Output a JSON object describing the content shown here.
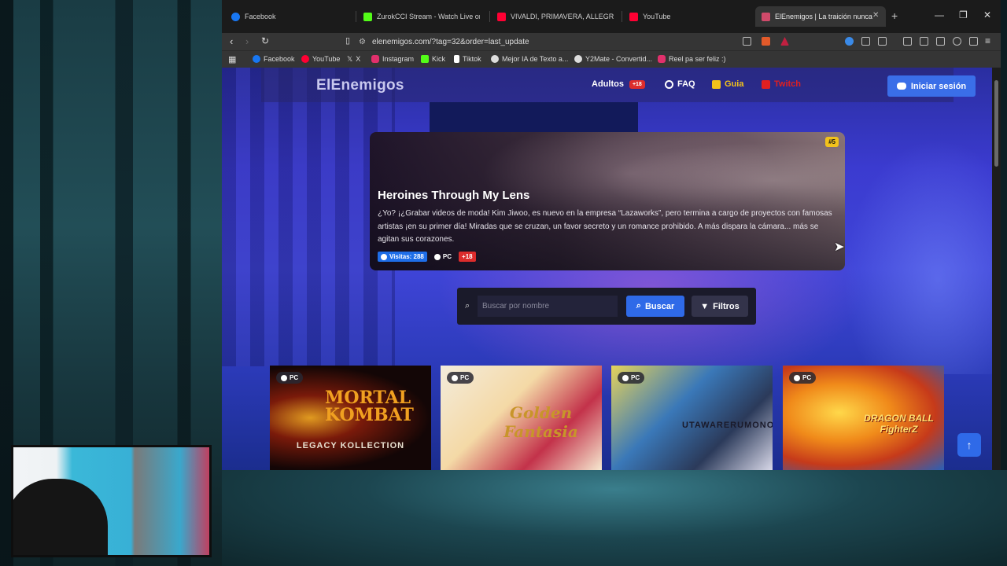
{
  "browser": {
    "tabs": [
      {
        "label": "Facebook",
        "color": "#1877f2"
      },
      {
        "label": "ZurokCCI Stream - Watch Live on Kick",
        "color": "#53fc18"
      },
      {
        "label": "VIVALDI, PRIMAVERA, ALLEGRO - YouTube",
        "color": "#ff0033"
      },
      {
        "label": "YouTube",
        "color": "#ff0033"
      },
      {
        "label": "ElEnemigos | La traición nunca vende",
        "color": "#d04a6a"
      }
    ],
    "new_tab": "+",
    "url": "elenemigos.com/?tag=32&order=last_update",
    "bookmarks": [
      {
        "label": "Facebook",
        "color": "#1877f2"
      },
      {
        "label": "YouTube",
        "color": "#ff0033"
      },
      {
        "label": "X",
        "color": "#ffffff"
      },
      {
        "label": "Instagram",
        "color": "#e1306c"
      },
      {
        "label": "Kick",
        "color": "#53fc18"
      },
      {
        "label": "Tiktok",
        "color": "#ffffff"
      },
      {
        "label": "Mejor IA de Texto a...",
        "color": "#ffffff"
      },
      {
        "label": "Y2Mate - Convertid...",
        "color": "#ffffff"
      },
      {
        "label": "Reel pa ser feliz :)",
        "color": "#e1306c"
      }
    ]
  },
  "site": {
    "logo": "ElEnemigos",
    "nav": {
      "adultos": "Adultos",
      "adultos_badge": "+18",
      "faq": "FAQ",
      "guia": "Guia",
      "twitch": "Twitch",
      "login": "Iniciar sesión"
    },
    "featured": {
      "rank": "#5",
      "title": "Heroines Through My Lens",
      "description": "¿Yo? ¡¿Grabar videos de moda! Kim Jiwoo, es nuevo en la empresa “Lazaworks”, pero termina a cargo de proyectos con famosas artistas ¡en su primer día! Miradas que se cruzan, un favor secreto y un romance prohibido. A más dispara la cámara... más se agitan sus corazones.",
      "views": "Visitas: 288",
      "platform": "PC",
      "adult": "+18"
    },
    "search": {
      "placeholder": "Buscar por nombre",
      "button": "Buscar",
      "filters": "Filtros"
    },
    "games": [
      {
        "platform": "PC",
        "title": "MORTAL KOMBAT",
        "subtitle": "LEGACY KOLLECTION"
      },
      {
        "platform": "PC",
        "title": "Golden Fantasia",
        "subtitle": ""
      },
      {
        "platform": "PC",
        "title": "UTAWARERUMONO",
        "subtitle": ""
      },
      {
        "platform": "PC",
        "title": "DRAGON BALL FighterZ",
        "subtitle": ""
      }
    ],
    "scroll_top": "↑"
  },
  "colors": {
    "accent_blue": "#2f6ae8",
    "adult_red": "#dc2c2c",
    "guia_yellow": "#f2c21b",
    "twitch_red": "#e02020"
  }
}
